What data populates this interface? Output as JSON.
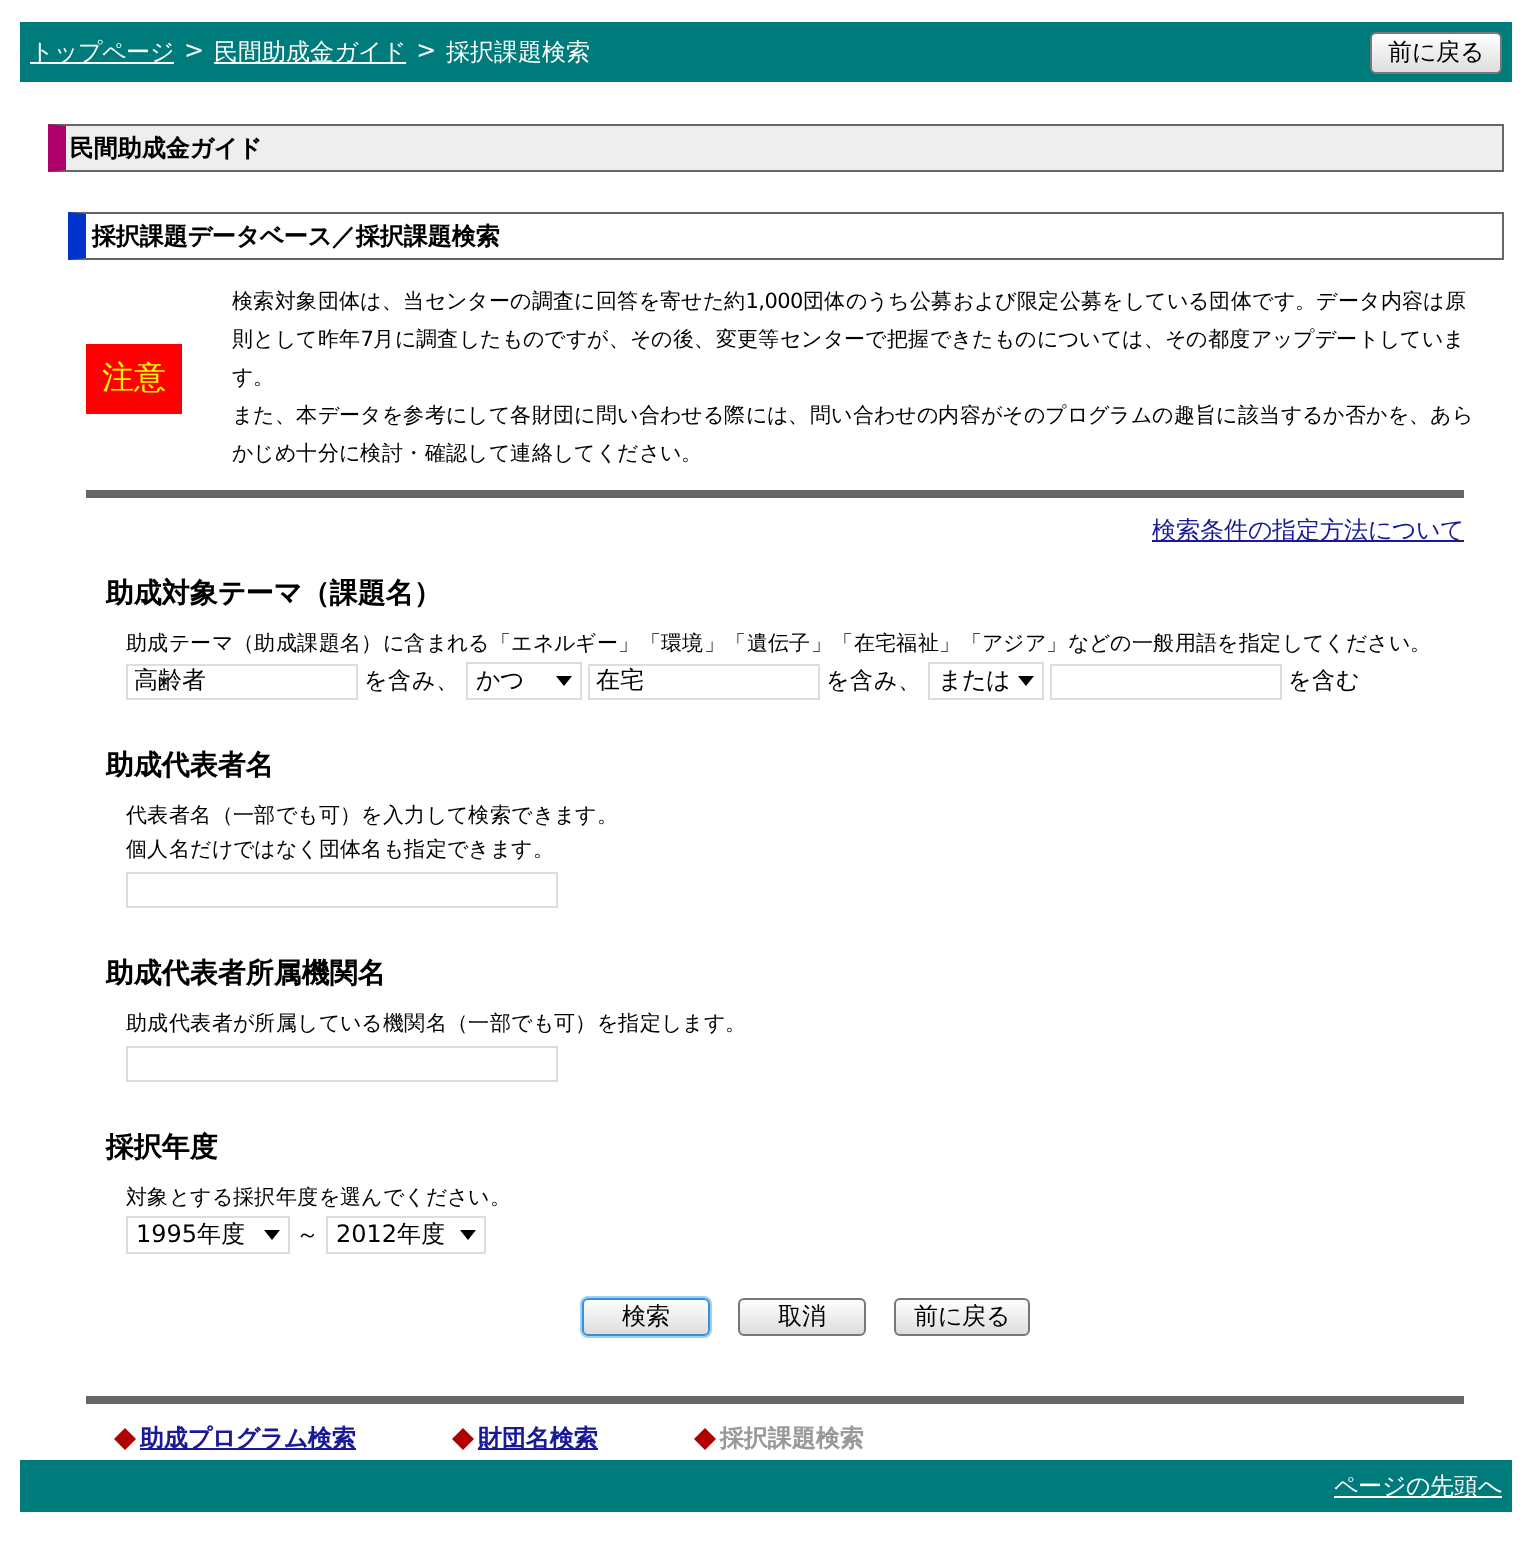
{
  "breadcrumb": [
    {
      "label": "トップページ",
      "link": true
    },
    {
      "label": "民間助成金ガイド",
      "link": true
    },
    {
      "label": "採択課題検索",
      "link": false
    }
  ],
  "separator": ">",
  "header_button": "前に戻る",
  "section_title": "民間助成金ガイド",
  "subsection_title": "採択課題データベース／採択課題検索",
  "notice": {
    "badge": "注意",
    "paragraphs": [
      "検索対象団体は、当センターの調査に回答を寄せた約1,000団体のうち公募および限定公募をしている団体です。データ内容は原則として昨年7月に調査したものですが、その後、変更等センターで把握できたものについては、その都度アップデートしています。",
      "また、本データを参考にして各財団に問い合わせる際には、問い合わせの内容がそのプログラムの趣旨に該当するか否かを、あらかじめ十分に検討・確認して連絡してください。"
    ]
  },
  "help_link": "検索条件の指定方法について",
  "theme": {
    "title": "助成対象テーマ（課題名）",
    "hint": "助成テーマ（助成課題名）に含まれる「エネルギー」「環境」「遺伝子」「在宅福祉」「アジア」などの一般用語を指定してください。",
    "term1": "高齢者",
    "suffix1": "を含み、",
    "op1": "かつ",
    "term2": "在宅",
    "suffix2": "を含み、",
    "op2": "または",
    "suffix3": "を含む"
  },
  "representative": {
    "title": "助成代表者名",
    "hints": [
      "代表者名（一部でも可）を入力して検索できます。",
      "個人名だけではなく団体名も指定できます。"
    ]
  },
  "affiliation": {
    "title": "助成代表者所属機関名",
    "hints": [
      "助成代表者が所属している機関名（一部でも可）を指定します。"
    ]
  },
  "year": {
    "title": "採択年度",
    "hint": "対象とする採択年度を選んでください。",
    "from": "1995年度",
    "tilde": "～",
    "to": "2012年度"
  },
  "buttons": [
    {
      "label": "検索",
      "focused": true
    },
    {
      "label": "取消",
      "focused": false
    },
    {
      "label": "前に戻る",
      "focused": false
    }
  ],
  "footer_nav": [
    {
      "label": "助成プログラム検索",
      "selected": false
    },
    {
      "label": "財団名検索",
      "selected": false
    },
    {
      "label": "採択課題検索",
      "selected": true
    }
  ],
  "footer_link": "ページの先頭へ"
}
